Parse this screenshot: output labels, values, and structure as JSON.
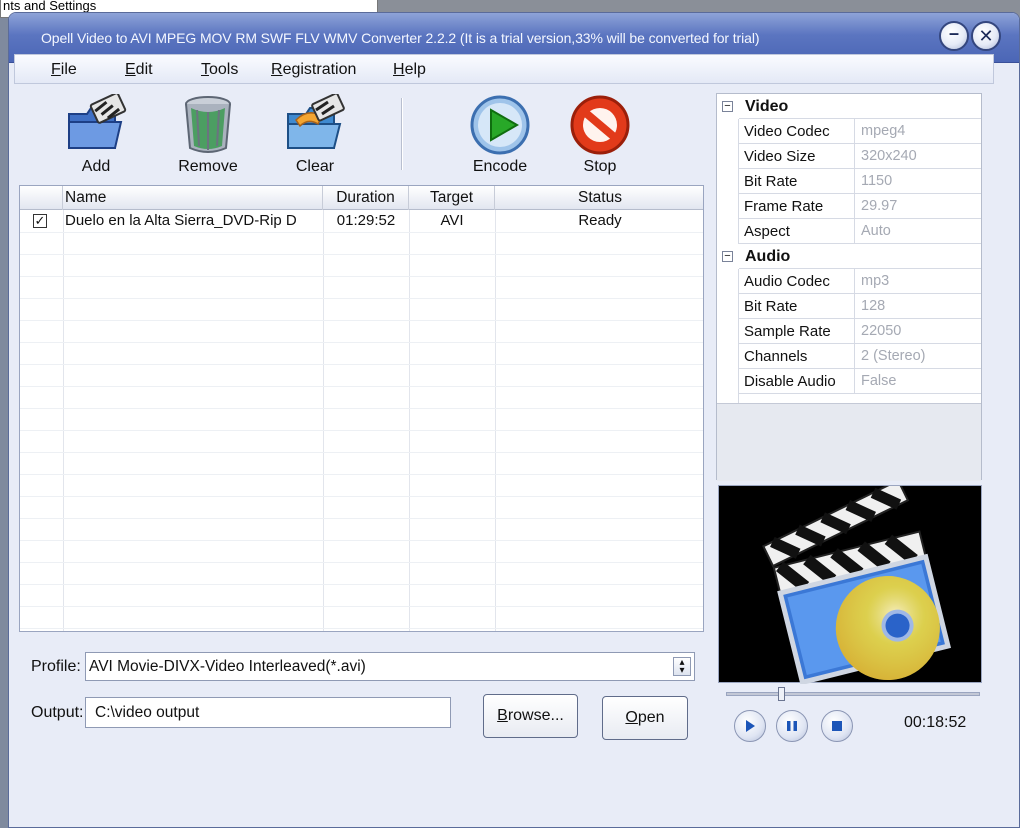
{
  "background_window": {
    "title_fragment": "nts and Settings"
  },
  "window": {
    "title": "Opell Video to AVI MPEG MOV RM SWF FLV WMV Converter 2.2.2 (It is a trial version,33% will be converted for trial)"
  },
  "menu": [
    {
      "u": "F",
      "rest": "ile"
    },
    {
      "u": "E",
      "rest": "dit"
    },
    {
      "u": "T",
      "rest": "ools"
    },
    {
      "u": "R",
      "rest": "egistration"
    },
    {
      "u": "H",
      "rest": "elp"
    }
  ],
  "toolbar": {
    "add": "Add",
    "remove": "Remove",
    "clear": "Clear",
    "encode": "Encode",
    "stop": "Stop"
  },
  "file_list": {
    "columns": [
      "Name",
      "Duration",
      "Target",
      "Status"
    ],
    "rows": [
      {
        "checked": true,
        "name": "Duelo en la Alta Sierra_DVD-Rip D",
        "duration": "01:29:52",
        "target": "AVI",
        "status": "Ready"
      }
    ]
  },
  "properties": {
    "video": {
      "label": "Video",
      "items": [
        {
          "name": "Video Codec",
          "value": "mpeg4"
        },
        {
          "name": "Video Size",
          "value": "320x240"
        },
        {
          "name": "Bit Rate",
          "value": "1150"
        },
        {
          "name": "Frame Rate",
          "value": "29.97"
        },
        {
          "name": "Aspect",
          "value": "Auto"
        }
      ]
    },
    "audio": {
      "label": "Audio",
      "items": [
        {
          "name": "Audio Codec",
          "value": "mp3"
        },
        {
          "name": "Bit Rate",
          "value": "128"
        },
        {
          "name": "Sample Rate",
          "value": "22050"
        },
        {
          "name": "Channels",
          "value": "2 (Stereo)"
        },
        {
          "name": "Disable Audio",
          "value": "False"
        }
      ]
    }
  },
  "form": {
    "profile_label": "Profile:",
    "profile_value": "AVI Movie-DIVX-Video Interleaved(*.avi)",
    "output_label": "Output:",
    "output_value": "C:\\video output",
    "browse": {
      "u": "B",
      "rest": "rowse..."
    },
    "open": {
      "u": "O",
      "rest": "pen"
    }
  },
  "player": {
    "time": "00:18:52",
    "progress": 0.21
  },
  "colors": {
    "titlebar": "#5b75c0",
    "encode": "#28a828",
    "stop": "#e23a1a"
  }
}
